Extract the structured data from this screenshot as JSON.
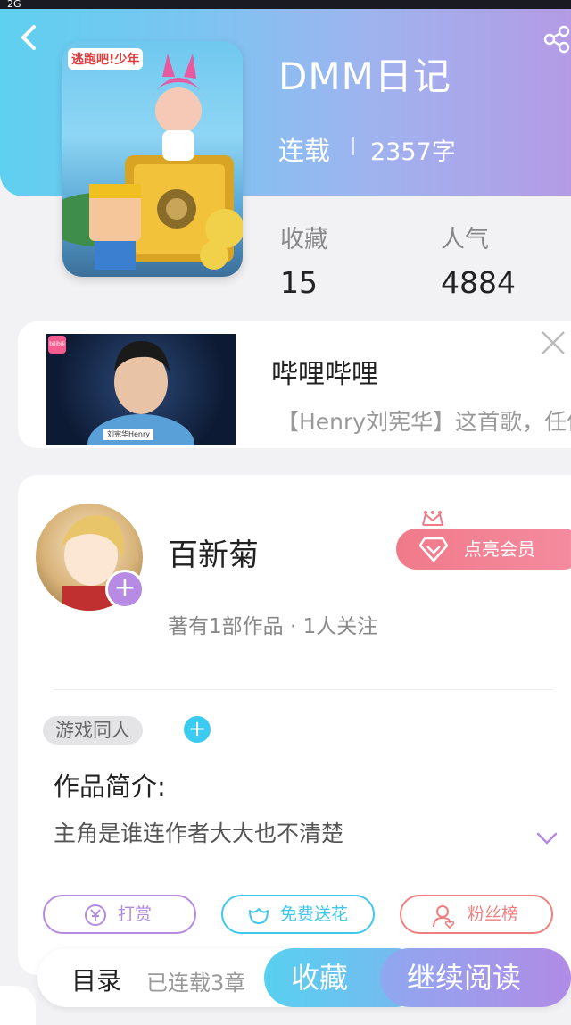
{
  "status_bar": {
    "signal_text": "2G"
  },
  "book": {
    "title": "DMM日记",
    "status": "连载",
    "word_count": "2357字",
    "stats": [
      {
        "label": "收藏",
        "value": "15"
      },
      {
        "label": "人气",
        "value": "4884"
      }
    ],
    "cover_logo": "逃跑吧!少年"
  },
  "ad": {
    "title": "哔哩哔哩",
    "description": "【Henry刘宪华】这首歌，任何时候听到都会心动！",
    "image_caption": "刘宪华Henry",
    "badge_text": "bilibili"
  },
  "author": {
    "name": "百新菊",
    "member_button": "点亮会员",
    "meta": "著有1部作品 · 1人关注",
    "tag": "游戏同人",
    "intro_title": "作品简介:",
    "intro_text": "主角是谁连作者大大也不清楚"
  },
  "actions": [
    {
      "label": "打赏",
      "color": "#b48be0"
    },
    {
      "label": "免费送花",
      "color": "#3fc8ec"
    },
    {
      "label": "粉丝榜",
      "color": "#ef7f7f"
    }
  ],
  "bottom_bar": {
    "toc_label": "目录",
    "chapters": "已连载3章",
    "favorite_button": "收藏",
    "read_button": "继续阅读"
  }
}
